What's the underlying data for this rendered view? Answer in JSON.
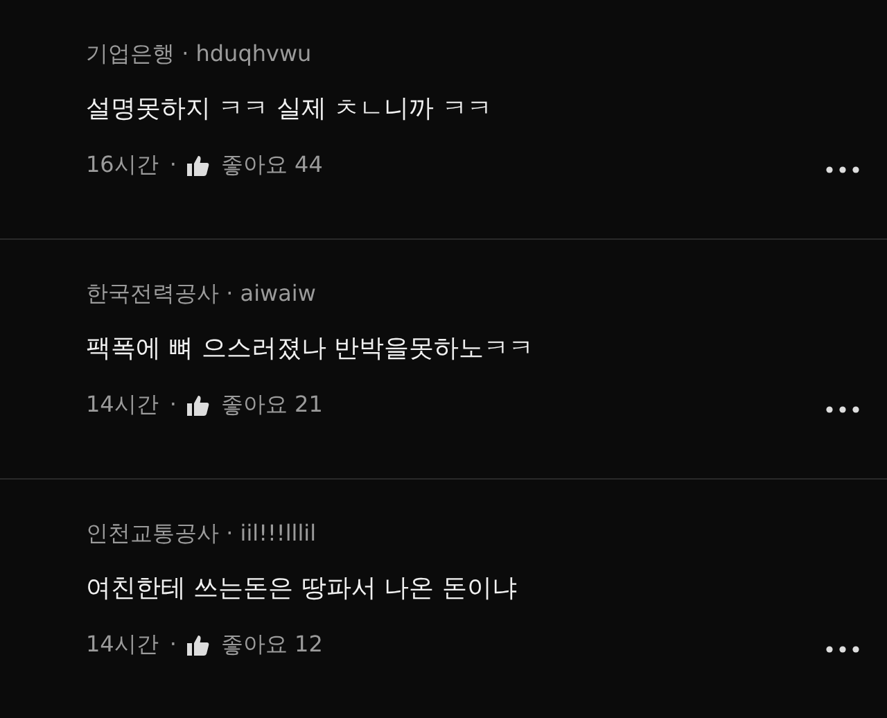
{
  "comments": [
    {
      "author": "기업은행 · hduqhvwu",
      "text": "설명못하지 ㅋㅋ 실제 ㅊㄴ니까 ㅋㅋ",
      "time": "16시간",
      "separator": "·",
      "likes": "좋아요 44"
    },
    {
      "author": "한국전력공사 · aiwaiw",
      "text": "팩폭에 뼈 으스러졌나 반박을못하노ㅋㅋ",
      "time": "14시간",
      "separator": "·",
      "likes": "좋아요 21"
    },
    {
      "author": "인천교통공사 · iil!!!lllil",
      "text": "여친한테 쓰는돈은 땅파서 나온 돈이냐",
      "time": "14시간",
      "separator": "·",
      "likes": "좋아요 12"
    }
  ]
}
